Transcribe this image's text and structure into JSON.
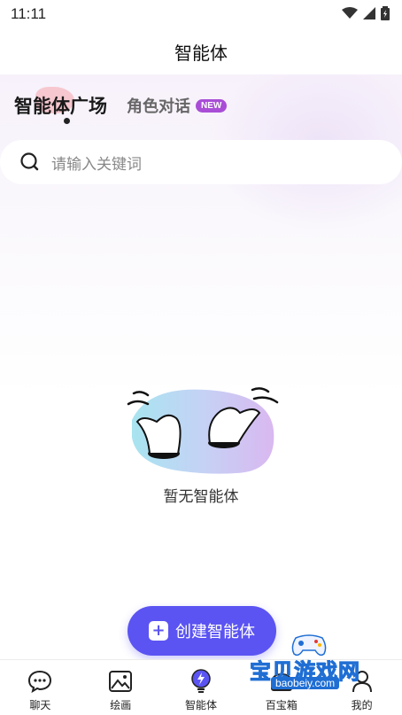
{
  "status_bar": {
    "time": "11:11"
  },
  "nav": {
    "title": "智能体"
  },
  "tabs": {
    "active": "智能体广场",
    "inactive": "角色对话",
    "badge": "NEW"
  },
  "search": {
    "placeholder": "请输入关键词"
  },
  "empty_state": {
    "text": "暂无智能体"
  },
  "create_button": {
    "label": "创建智能体"
  },
  "bottom_nav": [
    {
      "label": "聊天",
      "icon": "chat-bubble-icon"
    },
    {
      "label": "绘画",
      "icon": "image-icon"
    },
    {
      "label": "智能体",
      "icon": "lightbulb-icon"
    },
    {
      "label": "百宝箱",
      "icon": "toolbox-icon"
    },
    {
      "label": "我的",
      "icon": "user-icon"
    }
  ],
  "watermark": {
    "text": "宝贝游戏网",
    "url": "baobeiy.com"
  },
  "colors": {
    "accent": "#5b54f2",
    "badge": "#a94dd6"
  }
}
